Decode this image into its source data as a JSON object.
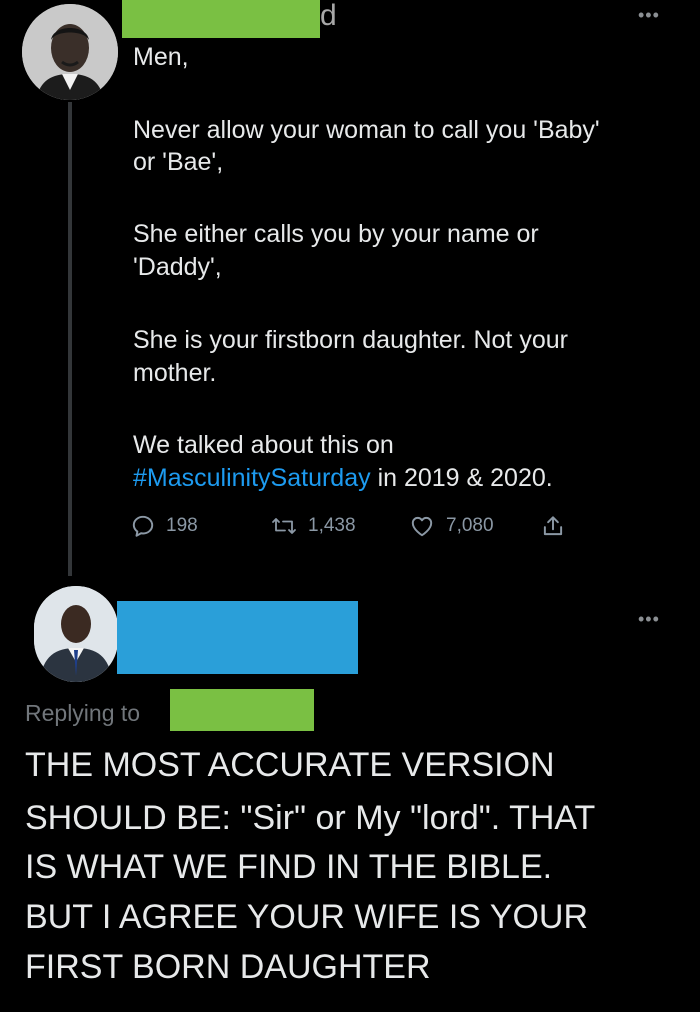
{
  "first_tweet": {
    "author_suffix": "d",
    "more_icon": "more-horizontal-icon",
    "lines": [
      "Men,",
      "Never allow your woman to call you 'Baby'",
      "or 'Bae',",
      "She either calls you by your name or",
      "'Daddy',",
      "She is your firstborn daughter. Not your",
      "mother.",
      "We talked about this on"
    ],
    "hashtag": "#MasculinitySaturday",
    "hashtag_suffix": " in 2019 & 2020.",
    "actions": {
      "reply_count": "198",
      "retweet_count": "1,438",
      "like_count": "7,080"
    },
    "redaction_color": "#7ac043"
  },
  "second_tweet": {
    "replying_label": "Replying to",
    "redaction_color_name": "#2a9fd9",
    "redaction_color_reply": "#7ac043",
    "lines": [
      "THE MOST ACCURATE VERSION",
      "SHOULD BE: \"Sir\" or My \"lord\". THAT",
      "IS WHAT WE FIND IN THE BIBLE.",
      "BUT I AGREE YOUR WIFE IS YOUR",
      "FIRST BORN DAUGHTER"
    ]
  },
  "colors": {
    "background": "#000000",
    "text": "#e7e9ea",
    "muted": "#71767b",
    "hashtag": "#1d9bf0"
  }
}
